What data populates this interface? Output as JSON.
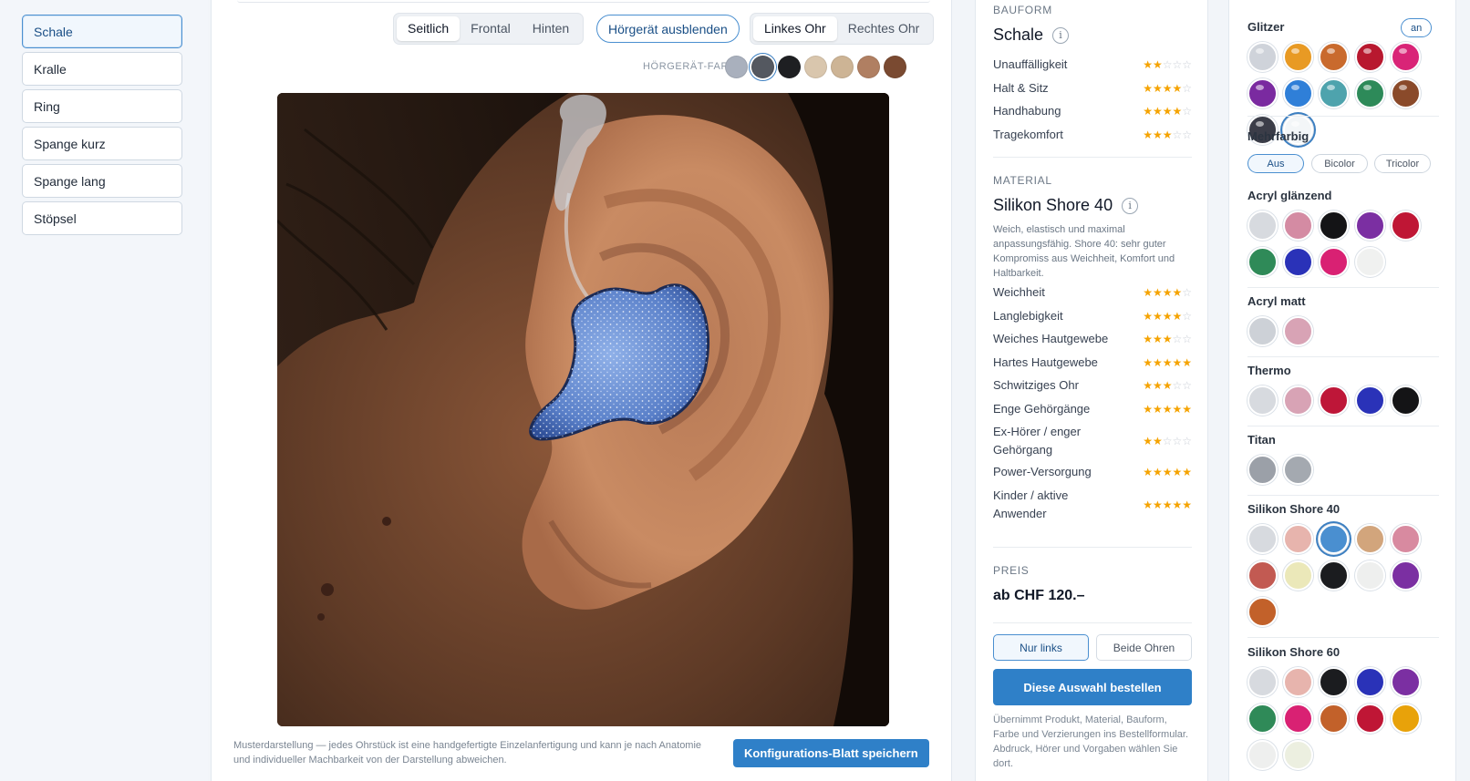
{
  "sidebar": {
    "items": [
      "Schale",
      "Kralle",
      "Ring",
      "Spange kurz",
      "Spange lang",
      "Stöpsel"
    ]
  },
  "viewer": {
    "views": [
      "Seitlich",
      "Frontal",
      "Hinten"
    ],
    "hide_aid": "Hörgerät ausblenden",
    "ears": [
      "Linkes Ohr",
      "Rechtes Ohr"
    ],
    "color_label": "HÖRGERÄT-FARBE",
    "aid_colors": [
      "#a9b0bd",
      "#545860",
      "#1e1f22",
      "#d9c6ad",
      "#cdb495",
      "#b07f62",
      "#7a4a31"
    ],
    "note": "Musterdarstellung — jedes Ohrstück ist eine handgefertigte Einzelanfertigung und kann je nach Anatomie und individueller Machbarkeit von der Darstellung abweichen.",
    "save_label": "Konfigurations-Blatt speichern"
  },
  "info": {
    "bauform_label": "BAUFORM",
    "bauform": "Schale",
    "bauform_ratings": [
      {
        "label": "Unauffälligkeit",
        "stars": 2
      },
      {
        "label": "Halt & Sitz",
        "stars": 4
      },
      {
        "label": "Handhabung",
        "stars": 4
      },
      {
        "label": "Tragekomfort",
        "stars": 3
      }
    ],
    "material_label": "MATERIAL",
    "material": "Silikon Shore 40",
    "material_desc": "Weich, elastisch und maximal anpassungsfähig. Shore 40: sehr guter Kompromiss aus Weichheit, Komfort und Haltbarkeit.",
    "material_ratings": [
      {
        "label": "Weichheit",
        "stars": 4
      },
      {
        "label": "Langlebigkeit",
        "stars": 4
      },
      {
        "label": "Weiches Hautgewebe",
        "stars": 3
      },
      {
        "label": "Hartes Hautgewebe",
        "stars": 5
      },
      {
        "label": "Schwitziges Ohr",
        "stars": 3
      },
      {
        "label": "Enge Gehörgänge",
        "stars": 5
      },
      {
        "label": "Ex-Hörer / enger Gehörgang",
        "stars": 2
      },
      {
        "label": "Power-Versorgung",
        "stars": 5
      },
      {
        "label": "Kinder / aktive Anwender",
        "stars": 5
      }
    ],
    "price_label": "PREIS",
    "price": "ab CHF 120.–",
    "ear_choice": [
      "Nur links",
      "Beide Ohren"
    ],
    "order_label": "Diese Auswahl bestellen",
    "order_note": "Übernimmt Produkt, Material, Bauform, Farbe und Verzierungen ins Bestellformular. Abdruck, Hörer und Vorgaben wählen Sie dort."
  },
  "colors": {
    "glitter_label": "Glitzer",
    "glitter_toggle": "an",
    "glitter": [
      "#cfd3da",
      "#e89a24",
      "#c96a2d",
      "#b8182f",
      "#d92477",
      "#7a2aa0",
      "#2f7fd8",
      "#4ea3ad",
      "#2d8a59",
      "#8a4a2a",
      "#3b3d48",
      "#f3f6f8"
    ],
    "mehrfarbig_label": "Mehrfarbig",
    "mehrfarbig_options": [
      "Aus",
      "Bicolor",
      "Tricolor"
    ],
    "groups": [
      {
        "name": "Acryl glänzend",
        "swatches": [
          "#d7dadf",
          "#d48ba3",
          "#141416",
          "#7b2fa2",
          "#bf1635",
          "#2f8a58",
          "#2a32b8",
          "#d92173",
          "#f0f1f0"
        ]
      },
      {
        "name": "Acryl matt",
        "swatches": [
          "#cdd1d7",
          "#d8a3b5"
        ]
      },
      {
        "name": "Thermo",
        "swatches": [
          "#d7dadf",
          "#d8a3b5",
          "#be1638",
          "#2a32b8",
          "#141416"
        ]
      },
      {
        "name": "Titan",
        "swatches": [
          "#9ba0a8",
          "#a4a9b0"
        ]
      },
      {
        "name": "Silikon Shore 40",
        "swatches": [
          "#d7dadf",
          "#e7b4ad",
          "#4a8fd0",
          "#d2a57c",
          "#d88aa0",
          "#c25a52",
          "#ebe8b9",
          "#1b1c1f",
          "#eeefee",
          "#7b2fa2",
          "#c2612a"
        ]
      },
      {
        "name": "Silikon Shore 60",
        "swatches": [
          "#d7dadf",
          "#e7b4ad",
          "#1b1c1f",
          "#2a32b8",
          "#7b2fa2",
          "#2f8a58",
          "#d92173",
          "#c2612a",
          "#bf1635",
          "#e8a20a",
          "#eeefee",
          "#ecefe0"
        ]
      }
    ]
  }
}
